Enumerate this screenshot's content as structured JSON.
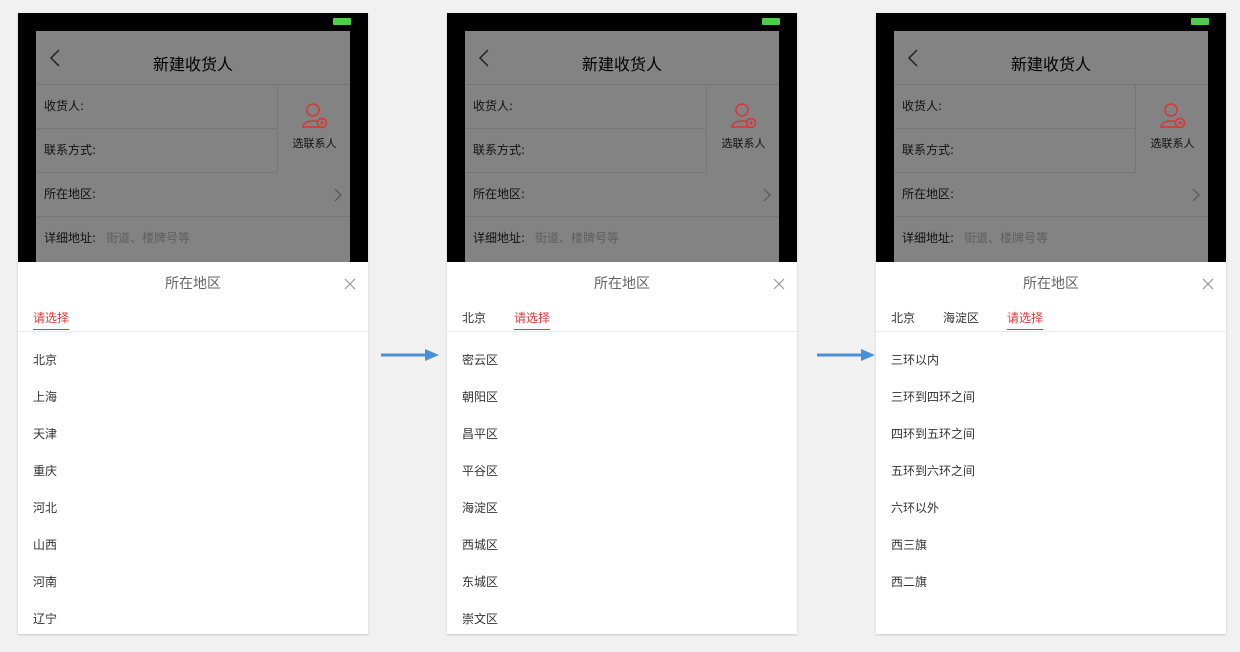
{
  "form": {
    "title": "新建收货人",
    "recipient_label": "收货人:",
    "contact_label": "联系方式:",
    "region_label": "所在地区:",
    "address_label": "详细地址:",
    "address_placeholder": "街道、楼牌号等",
    "pick_contact_label": "选联系人"
  },
  "sheet": {
    "title": "所在地区"
  },
  "steps": [
    {
      "tabs": [
        {
          "label": "请选择",
          "active": true
        }
      ],
      "items": [
        "北京",
        "上海",
        "天津",
        "重庆",
        "河北",
        "山西",
        "河南",
        "辽宁"
      ]
    },
    {
      "tabs": [
        {
          "label": "北京",
          "active": false
        },
        {
          "label": "请选择",
          "active": true
        }
      ],
      "items": [
        "密云区",
        "朝阳区",
        "昌平区",
        "平谷区",
        "海淀区",
        "西城区",
        "东城区",
        "崇文区"
      ]
    },
    {
      "tabs": [
        {
          "label": "北京",
          "active": false
        },
        {
          "label": "海淀区",
          "active": false
        },
        {
          "label": "请选择",
          "active": true
        }
      ],
      "items": [
        "三环以内",
        "三环到四环之间",
        "四环到五环之间",
        "五环到六环之间",
        "六环以外",
        "西三旗",
        "西二旗"
      ]
    }
  ],
  "colors": {
    "accent": "#e4393c",
    "arrow": "#4a90d9",
    "battery": "#4ccd4c"
  },
  "icons": [
    "back-icon",
    "chevron-right-icon",
    "add-contact-icon",
    "close-icon",
    "arrow-right-icon",
    "battery-icon"
  ]
}
